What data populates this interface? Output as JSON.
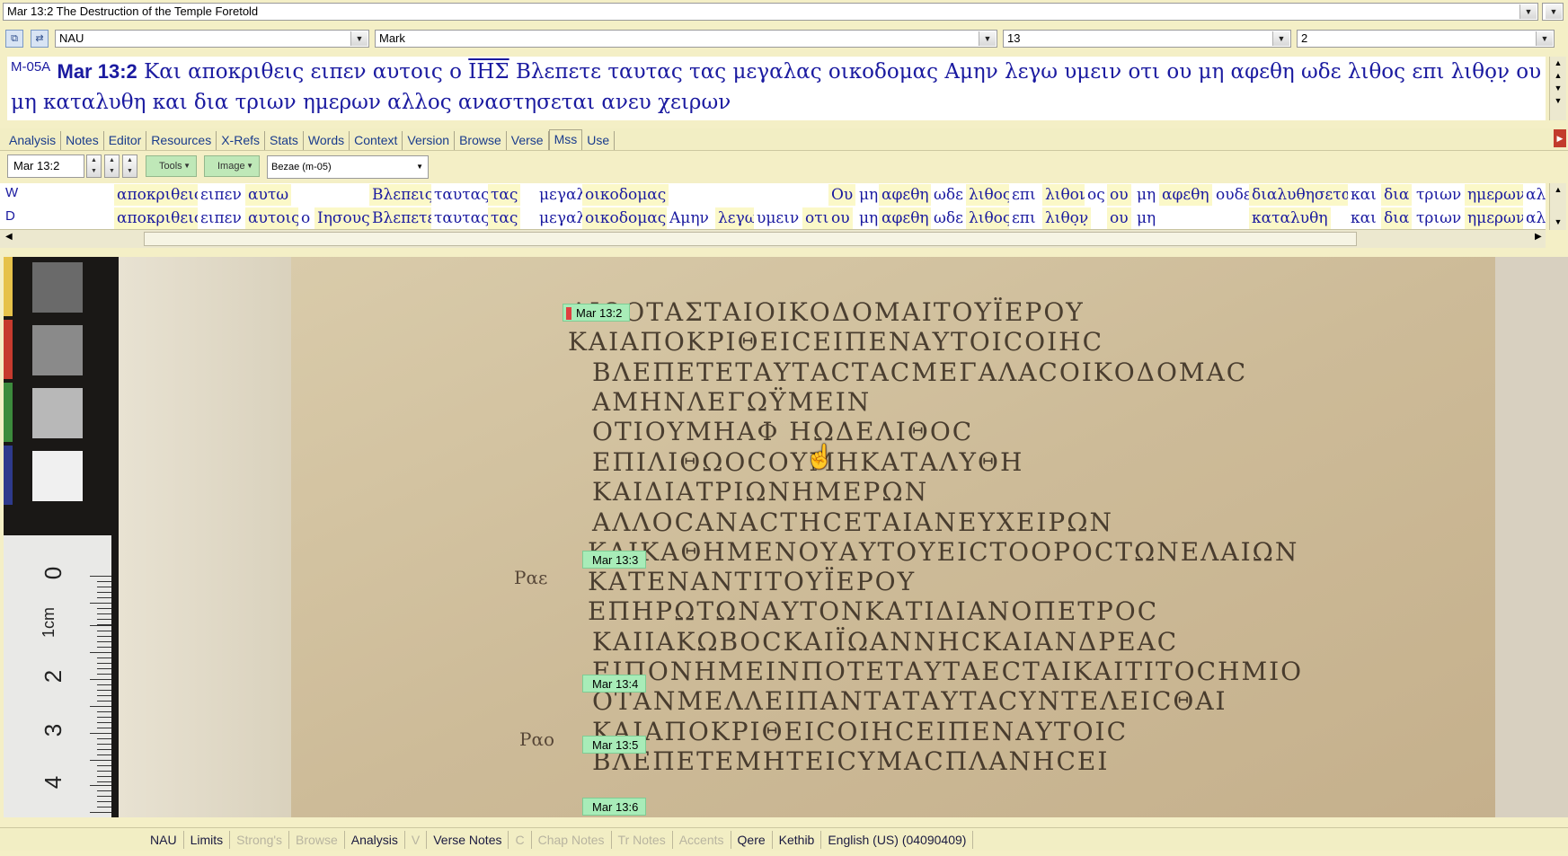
{
  "window": {
    "title": "Mar 13:2 The Destruction of the Temple Foretold"
  },
  "nav": {
    "version": "NAU",
    "book": "Mark",
    "chapter": "13",
    "verse": "2"
  },
  "verse_panel": {
    "siglum": "M-05A",
    "reference": "Mar 13:2",
    "text_before": "Και αποκριθεις ειπεν αυτοις ο",
    "nomen_sacrum": "ΙΗΣ",
    "text_after": "Βλεπετε ταυτας τας μεγαλας οικοδομας Αμην λεγω υμειν οτι ου μη αφεθη ωδε λιθος επι λιθο̣ν̣ ου μη καταλυθη και δια τριων ημερων αλλος αναστησεται ανευ χειρων"
  },
  "tabs": [
    {
      "label": "Analysis"
    },
    {
      "label": "Notes"
    },
    {
      "label": "Editor"
    },
    {
      "label": "Resources"
    },
    {
      "label": "X-Refs"
    },
    {
      "label": "Stats"
    },
    {
      "label": "Words"
    },
    {
      "label": "Context"
    },
    {
      "label": "Version"
    },
    {
      "label": "Browse"
    },
    {
      "label": "Verse"
    },
    {
      "label": "Mss",
      "active": true
    },
    {
      "label": "Use"
    }
  ],
  "toolbar": {
    "ref_value": "Mar 13:2",
    "tools_label": "Tools",
    "image_label": "Image",
    "manuscript_select": "Bezae (m-05)"
  },
  "manuscripts": {
    "rows": [
      {
        "siglum": "W",
        "words": [
          {
            "t": "αποκριθεις",
            "bg": "y"
          },
          {
            "t": "ειπεν",
            "bg": "w"
          },
          {
            "t": "αυτω",
            "bg": "y"
          },
          {
            "t": "Βλεπεις",
            "bg": "y"
          },
          {
            "t": "ταυτας",
            "bg": "w"
          },
          {
            "t": "τας",
            "bg": "y"
          },
          {
            "t": "μεγαλας",
            "bg": "w"
          },
          {
            "t": "οικοδομας",
            "bg": "y"
          },
          {
            "t": "Ου",
            "bg": "y"
          },
          {
            "t": "μη",
            "bg": "w"
          },
          {
            "t": "αφεθη",
            "bg": "y"
          },
          {
            "t": "ωδε",
            "bg": "w"
          },
          {
            "t": "λιθος",
            "bg": "y"
          },
          {
            "t": "επι",
            "bg": "w"
          },
          {
            "t": "λιθον",
            "bg": "y"
          },
          {
            "t": "ος",
            "bg": "w"
          },
          {
            "t": "ου",
            "bg": "y"
          },
          {
            "t": "μη",
            "bg": "w"
          },
          {
            "t": "αφεθη",
            "bg": "y"
          },
          {
            "t": "ουδε",
            "bg": "w"
          },
          {
            "t": "διαλυθησεται",
            "bg": "y"
          },
          {
            "t": "και",
            "bg": "w"
          },
          {
            "t": "δια",
            "bg": "y"
          },
          {
            "t": "τριων",
            "bg": "w"
          },
          {
            "t": "ημερων",
            "bg": "y"
          },
          {
            "t": "αλλ",
            "bg": "w"
          }
        ]
      },
      {
        "siglum": "D",
        "words": [
          {
            "t": "αποκριθεις",
            "bg": "y"
          },
          {
            "t": "ειπεν",
            "bg": "w"
          },
          {
            "t": "αυτοις",
            "bg": "y"
          },
          {
            "t": "ο",
            "bg": "w"
          },
          {
            "t": "Ιησους",
            "bg": "y"
          },
          {
            "t": "Βλεπετε",
            "bg": "y"
          },
          {
            "t": "ταυτας",
            "bg": "w"
          },
          {
            "t": "τας",
            "bg": "y"
          },
          {
            "t": "μεγαλας",
            "bg": "w"
          },
          {
            "t": "οικοδομας",
            "bg": "y"
          },
          {
            "t": "Αμην",
            "bg": "w"
          },
          {
            "t": "λεγω",
            "bg": "y"
          },
          {
            "t": "υμειν",
            "bg": "w"
          },
          {
            "t": "οτι",
            "bg": "y"
          },
          {
            "t": "ου",
            "bg": "y"
          },
          {
            "t": "μη",
            "bg": "w"
          },
          {
            "t": "αφεθη",
            "bg": "y"
          },
          {
            "t": "ωδε",
            "bg": "w"
          },
          {
            "t": "λιθος",
            "bg": "y"
          },
          {
            "t": "επι",
            "bg": "w"
          },
          {
            "t": "λιθο̣ν̣",
            "bg": "y"
          },
          {
            "t": "ου",
            "bg": "y"
          },
          {
            "t": "μη",
            "bg": "w"
          },
          {
            "t": "καταλυθη",
            "bg": "y"
          },
          {
            "t": "και",
            "bg": "w"
          },
          {
            "t": "δια",
            "bg": "y"
          },
          {
            "t": "τριων",
            "bg": "w"
          },
          {
            "t": "ημερων",
            "bg": "y"
          },
          {
            "t": "αλλ",
            "bg": "w"
          }
        ]
      }
    ]
  },
  "image_view": {
    "verse_tags": [
      "Mar 13:2",
      "Mar 13:3",
      "Mar 13:4",
      "Mar 13:5",
      "Mar 13:6"
    ],
    "ruler_marks": [
      "0",
      "1cm",
      "2",
      "3",
      "4"
    ],
    "manuscript_lines": [
      "ΛΙΘΟΤΑΣΤΑΙΟΙΚΟΔΟΜΑΙΤΟΥΪΕΡΟΥ",
      "ΚΑΙΑΠΟΚΡΙΘΕΙCΕΙΠΕΝΑΥΤΟΙCΟΙΗC",
      "ΒΛΕΠΕΤΕΤΑΥΤΑCΤΑCΜΕΓΑΛΑCΟΙΚΟΔΟΜΑC",
      "ΑΜΗΝΛΕΓΩΫΜΕΙΝ",
      "ΟΤΙΟΥΜΗΑΦ ΗΩΔΕΛΙΘΟC",
      "ΕΠΙΛΙΘΩΟCΟΥΜΗΚΑΤΑΛΥΘΗ",
      "ΚΑΙΔΙΑΤΡΙΩΝΗΜΕΡΩΝ",
      "ΑΛΛΟCΑΝΑCΤΗCΕΤΑΙΑΝΕΥΧΕΙΡΩΝ",
      "ΚΑΙΚΑΘΗΜΕΝΟΥΑΥΤΟΥΕΙCΤΟΟΡΟCΤΩΝΕΛΑΙΩΝ",
      "ΚΑΤΕΝΑΝΤΙΤΟΥΪΕΡΟΥ",
      "ΕΠΗΡΩΤΩΝΑΥΤΟΝΚΑΤΙΔΙΑΝΟΠΕΤΡΟC",
      "ΚΑΙΙΑΚΩΒΟCΚΑΙΪΩΑΝΝΗCΚΑΙΑΝΔΡΕΑC",
      "ΕΙΠΟΝΗΜΕΙΝΠΟΤΕΤΑΥΤΑΕCΤΑΙΚΑΙΤΙΤΟCΗΜΙΟ",
      "ΟΤΑΝΜΕΛΛΕΙΠΑΝΤΑΤΑΥΤΑCΥΝΤΕΛΕΙCΘΑΙ",
      "ΚΑΙΑΠΟΚΡΙΘΕΙCΟΙΗCΕΙΠΕΝΑΥΤΟΙC",
      "ΒΛΕΠΕΤΕΜΗΤΕΙCΥΜΑCΠΛΑΝΗCΕΙ"
    ],
    "margin_notes": [
      "Ραε",
      "Ραο"
    ],
    "color_chart": [
      "#e6c24a",
      "#c63a2e",
      "#3c8a3c",
      "#2e3a8c"
    ]
  },
  "status": {
    "items": [
      {
        "label": "NAU",
        "enabled": true
      },
      {
        "label": "Limits",
        "enabled": true
      },
      {
        "label": "Strong's",
        "enabled": false
      },
      {
        "label": "Browse",
        "enabled": false
      },
      {
        "label": "Analysis",
        "enabled": true
      },
      {
        "label": "V",
        "enabled": false
      },
      {
        "label": "Verse Notes",
        "enabled": true
      },
      {
        "label": "C",
        "enabled": false
      },
      {
        "label": "Chap Notes",
        "enabled": false
      },
      {
        "label": "Tr Notes",
        "enabled": false
      },
      {
        "label": "Accents",
        "enabled": false
      },
      {
        "label": "Qere",
        "enabled": true
      },
      {
        "label": "Kethib",
        "enabled": true
      },
      {
        "label": "English (US)  (04090409)",
        "enabled": true
      }
    ]
  }
}
